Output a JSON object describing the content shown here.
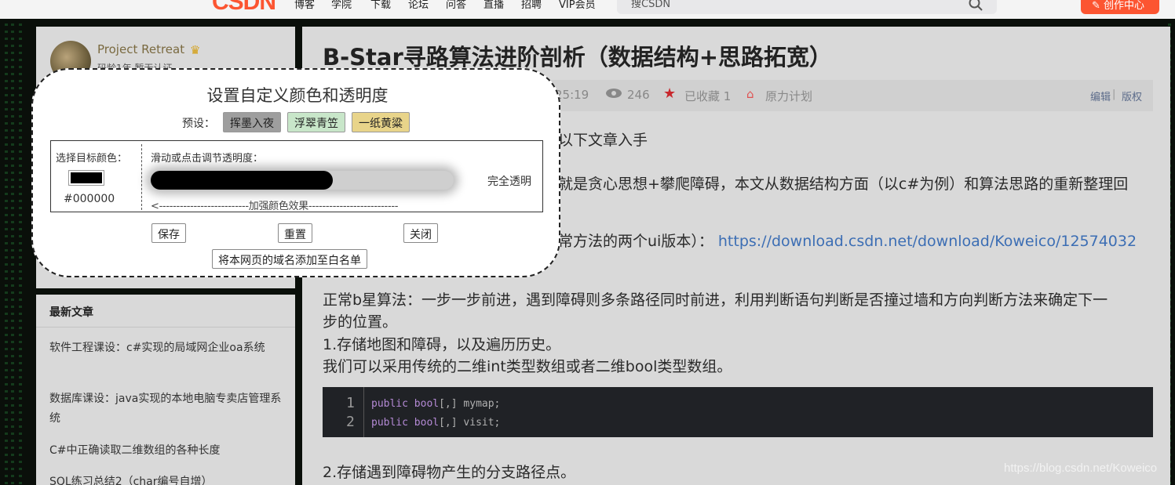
{
  "nav": {
    "logo": "CSDN",
    "items": [
      "博客",
      "学院",
      "下载",
      "论坛",
      "问答",
      "直播",
      "招聘",
      "VIP会员"
    ],
    "search_placeholder": "搜CSDN",
    "create_label": "创作中心"
  },
  "sidebar": {
    "username": "Project Retreat",
    "profile_sub": "码龄1年  暂无认证",
    "recent_title": "最新文章",
    "recent_items": [
      "软件工程课设：c#实现的局域网企业oa系统",
      "数据库课设：java实现的本地电脑专卖店管理系统",
      "C#中正确读取二维数组的各种长度",
      "SQL练习总结2（char编号自增）"
    ]
  },
  "article": {
    "title": "B-Star寻路算法进阶剖析（数据结构+思路拓宽）",
    "meta": {
      "time": "25:19",
      "views": "246",
      "collected": "已收藏 1",
      "plan": "原力计划",
      "edit": "编辑",
      "copyright": "版权"
    },
    "paragraphs": [
      "以下文章入手",
      "就是贪心思想+攀爬障碍，本文从数据结构方面（以c#为例）和算法思路的重新整理回",
      "常方法的两个ui版本）：",
      "正常b星算法：一步一步前进，遇到障碍则多条路径同时前进，利用判断语句判断是否撞过墙和方向判断方法来确定下一",
      "步的位置。",
      "1.存储地图和障碍，以及遍历历史。",
      "我们可以采用传统的二维int类型数组或者二维bool类型数组。",
      "2.存储遇到障碍物产生的分支路径点。"
    ],
    "link": "https://download.csdn.net/download/Koweico/12574032",
    "code_lines": [
      {
        "num": "1",
        "kw1": "public",
        "kw2": "bool",
        "rest": "[,] mymap;"
      },
      {
        "num": "2",
        "kw1": "public",
        "kw2": "bool",
        "rest": "[,] visit;"
      }
    ],
    "watermark": "https://blog.csdn.net/Koweico"
  },
  "modal": {
    "title": "设置自定义颜色和透明度",
    "preset_label": "预设：",
    "presets": [
      {
        "label": "挥墨入夜",
        "color": "#9e9e9e"
      },
      {
        "label": "浮翠青笠",
        "color": "#c8e6c9"
      },
      {
        "label": "一纸黄粱",
        "color": "#e8d48a"
      }
    ],
    "color_label": "选择目标颜色：",
    "color_value": "#000000",
    "slider_label": "滑动或点击调节透明度：",
    "opacity_fraction": 0.6,
    "full_transparent": "完全透明",
    "enhance_hint": "<--------------------------加强颜色效果--------------------------",
    "save": "保存",
    "reset": "重置",
    "close": "关闭",
    "whitelist": "将本网页的域名添加至白名单"
  },
  "colors": {
    "brand": "#fc5531",
    "link": "#3c6eb4"
  }
}
